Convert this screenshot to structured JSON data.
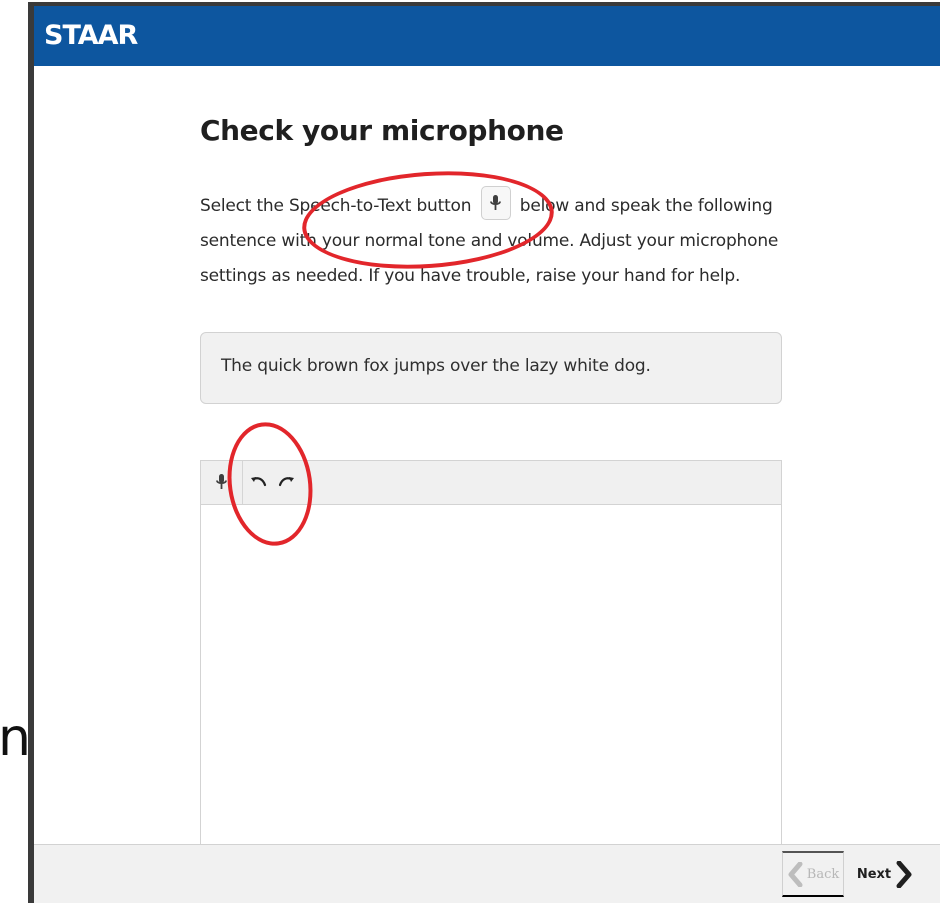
{
  "app": {
    "brand": "STAAR"
  },
  "page": {
    "title": "Check your microphone",
    "instruction_before": "Select the Speech-to-Text button",
    "instruction_after": "below and speak the following sentence with your normal tone and volume. Adjust your microphone settings as needed. If you have trouble, raise your hand for help.",
    "sample_sentence": "The quick brown fox jumps over the lazy white dog."
  },
  "editor": {
    "toolbar": {
      "mic_icon": "microphone-icon",
      "undo_icon": "undo-icon",
      "redo_icon": "redo-icon"
    },
    "value": ""
  },
  "navigation": {
    "back_label": "Back",
    "next_label": "Next"
  },
  "overlay": {
    "cropped_text": "n"
  },
  "colors": {
    "header": "#0d569f",
    "annotation": "#e2262b",
    "panel": "#f1f1f1",
    "text": "#2b2b2b"
  }
}
